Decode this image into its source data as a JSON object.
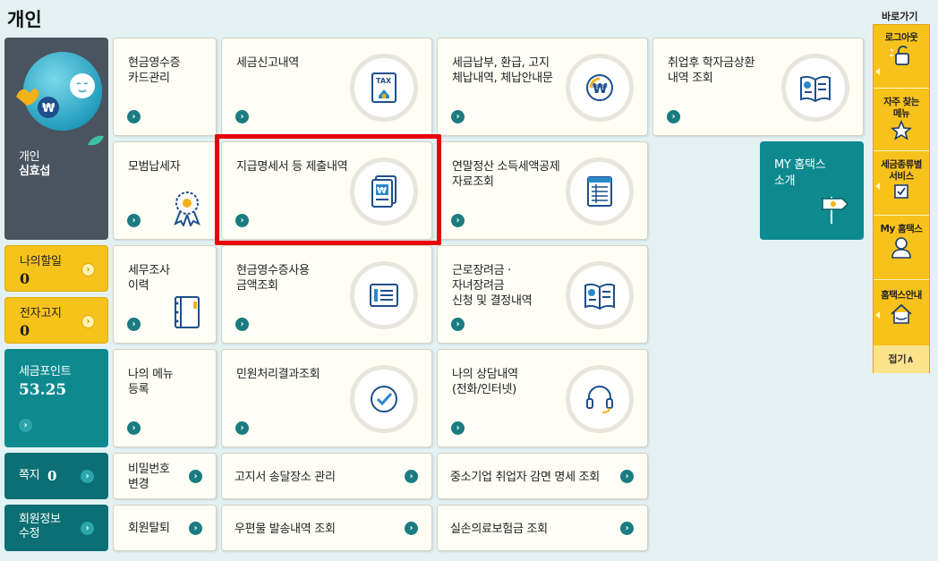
{
  "page": {
    "title": "개인"
  },
  "profile": {
    "line1": "개인",
    "line2": "심효섭"
  },
  "side": {
    "todo_label": "나의할일",
    "todo_value": "0",
    "notice_label": "전자고지",
    "notice_value": "0",
    "points_label": "세금포인트",
    "points_value": "53.25",
    "memo_label": "쪽지",
    "memo_value": "0",
    "member_edit": "회원정보\n수정"
  },
  "tiles": {
    "cash_receipt_card": "현금영수증\n카드관리",
    "tax_report": "세금신고내역",
    "tax_payment": "세금납부, 환급, 고지\n체납내역, 체납안내문",
    "student_loan": "취업후 학자금상환\n내역 조회",
    "model_taxpayer": "모범납세자",
    "payment_statement": "지급명세서 등 제출내역",
    "year_end": "연말정산 소득세액공제\n자료조회",
    "tax_audit": "세무조사\n이력",
    "cash_receipt_amount": "현금영수증사용\n금액조회",
    "earned_income": "근로장려금 ·\n자녀장려금\n신청 및 결정내역",
    "my_menu": "나의 메뉴\n등록",
    "civil_result": "민원처리결과조회",
    "consult": "나의 상담내역\n(전화/인터넷)",
    "password_change": "비밀번호\n변경",
    "notice_address": "고지서 송달장소 관리",
    "sme_exemption": "중소기업 취업자 감면 명세 조회",
    "withdraw": "회원탈퇴",
    "mail_history": "우편물 발송내역 조회",
    "insurance": "실손의료보험금 조회"
  },
  "my_hometax": {
    "label": "MY 홈택스\n소개"
  },
  "quick_menu": {
    "title": "바로가기",
    "logout": "로그아웃",
    "faq": "자주 찾는\n메뉴",
    "tax_service": "세금종류별\n서비스",
    "my_hometax": "My 홈택스",
    "guide": "홈택스안내",
    "fold": "접기∧"
  },
  "icons": {
    "tax_doc": "tax-document-icon",
    "won_coin": "won-coin-icon",
    "book": "open-book-icon",
    "medal": "medal-icon",
    "won_doc": "won-document-icon",
    "spreadsheet": "spreadsheet-icon",
    "notebook": "notebook-icon",
    "list_doc": "list-document-icon",
    "check": "check-circle-icon",
    "headset": "headset-icon"
  },
  "colors": {
    "accent": "#0e8a8f",
    "highlight": "#e8000b",
    "yellow": "#f6c21c",
    "dark": "#4a5460"
  }
}
